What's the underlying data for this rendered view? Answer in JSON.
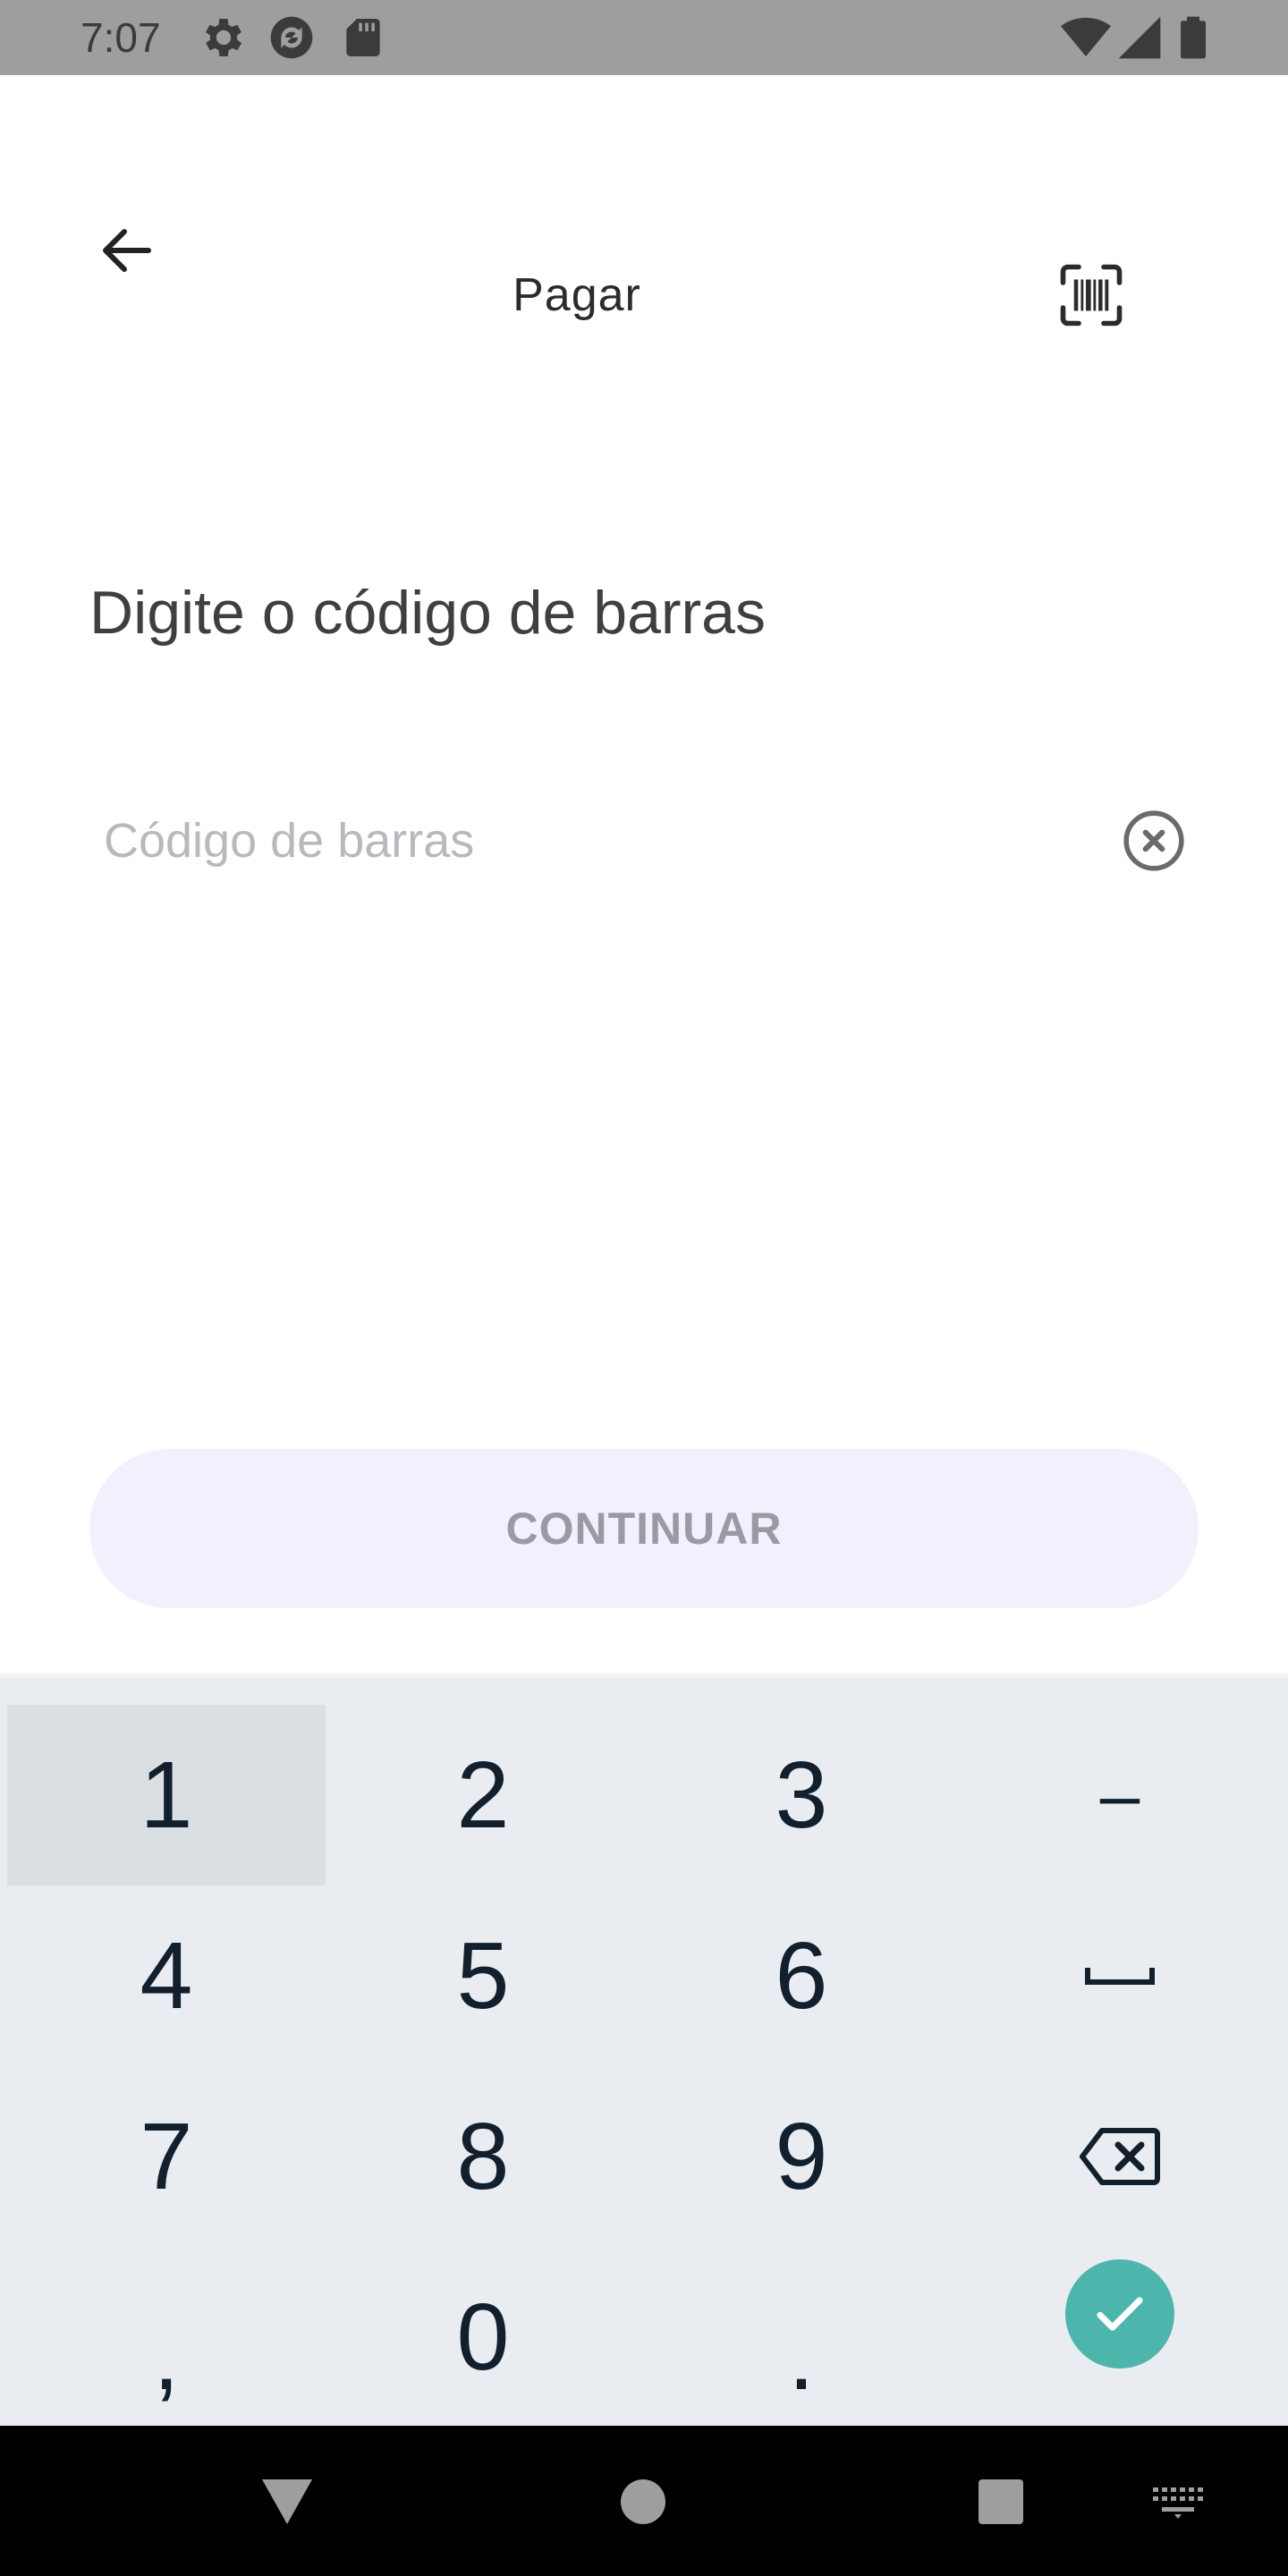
{
  "status_bar": {
    "time": "7:07",
    "icons": [
      "settings-icon",
      "sync-icon",
      "sd-card-icon",
      "wifi-icon",
      "signal-icon",
      "battery-icon"
    ]
  },
  "toolbar": {
    "title": "Pagar",
    "back_icon": "arrow-left-icon",
    "scan_icon": "barcode-scan-icon"
  },
  "form": {
    "instruction": "Digite o código de barras",
    "barcode_value": "",
    "barcode_placeholder": "Código de barras",
    "clear_icon": "close-circle-icon",
    "continue_label": "CONTINUAR"
  },
  "keyboard": {
    "keys": {
      "k1": "1",
      "k2": "2",
      "k3": "3",
      "dash": "–",
      "k4": "4",
      "k5": "5",
      "k6": "6",
      "k7": "7",
      "k8": "8",
      "k9": "9",
      "comma": ",",
      "k0": "0",
      "period": "."
    },
    "special_icons": [
      "space-icon",
      "backspace-icon",
      "done-check-icon"
    ],
    "pressed_key": "1"
  },
  "nav_bar": {
    "icons": [
      "back-triangle-icon",
      "home-circle-icon",
      "recents-square-icon",
      "keyboard-switch-icon"
    ]
  },
  "colors": {
    "status_bar_bg": "#9e9e9e",
    "continue_bg": "#f3f0fd",
    "continue_text": "#9a9aa3",
    "keyboard_bg": "#e9edf1",
    "done_accent": "#4db6ac"
  }
}
